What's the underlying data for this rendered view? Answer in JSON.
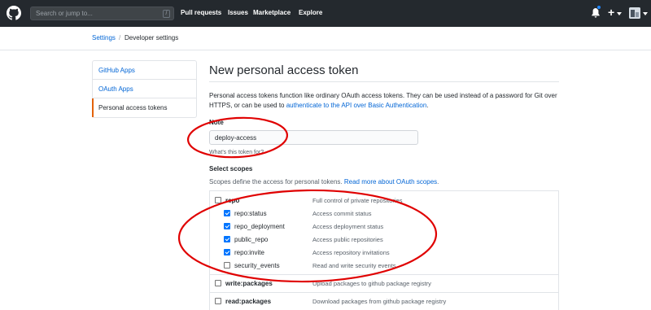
{
  "header": {
    "search_placeholder": "Search or jump to...",
    "search_shortcut": "/",
    "nav": [
      "Pull requests",
      "Issues",
      "Marketplace",
      "Explore"
    ],
    "plus_icon": "+"
  },
  "breadcrumb": {
    "parent": "Settings",
    "separator": "/",
    "current": "Developer settings"
  },
  "sidebar": {
    "items": [
      {
        "label": "GitHub Apps",
        "active": false
      },
      {
        "label": "OAuth Apps",
        "active": false
      },
      {
        "label": "Personal access tokens",
        "active": true
      }
    ]
  },
  "main": {
    "title": "New personal access token",
    "intro_text": "Personal access tokens function like ordinary OAuth access tokens. They can be used instead of a password for Git over HTTPS, or can be used to ",
    "intro_link": "authenticate to the API over Basic Authentication",
    "intro_end": ".",
    "note_label": "Note",
    "note_value": "deploy-access",
    "note_hint": "What's this token for?",
    "scopes_label": "Select scopes",
    "scopes_desc": "Scopes define the access for personal tokens. ",
    "scopes_link": "Read more about OAuth scopes",
    "scopes_end": "."
  },
  "scopes": {
    "repo": {
      "name": "repo",
      "desc": "Full control of private repositories",
      "checked": false
    },
    "repo_children": [
      {
        "name": "repo:status",
        "desc": "Access commit status",
        "checked": true
      },
      {
        "name": "repo_deployment",
        "desc": "Access deployment status",
        "checked": true
      },
      {
        "name": "public_repo",
        "desc": "Access public repositories",
        "checked": true
      },
      {
        "name": "repo:invite",
        "desc": "Access repository invitations",
        "checked": true
      },
      {
        "name": "security_events",
        "desc": "Read and write security events",
        "checked": false
      }
    ],
    "write_packages": {
      "name": "write:packages",
      "desc": "Upload packages to github package registry",
      "checked": false
    },
    "read_packages": {
      "name": "read:packages",
      "desc": "Download packages from github package registry",
      "checked": false
    }
  },
  "colors": {
    "header_bg": "#24292e",
    "link": "#0366d6",
    "active_bar": "#e36209",
    "annotation": "#e00000",
    "checkbox_checked": "#0075ff"
  }
}
